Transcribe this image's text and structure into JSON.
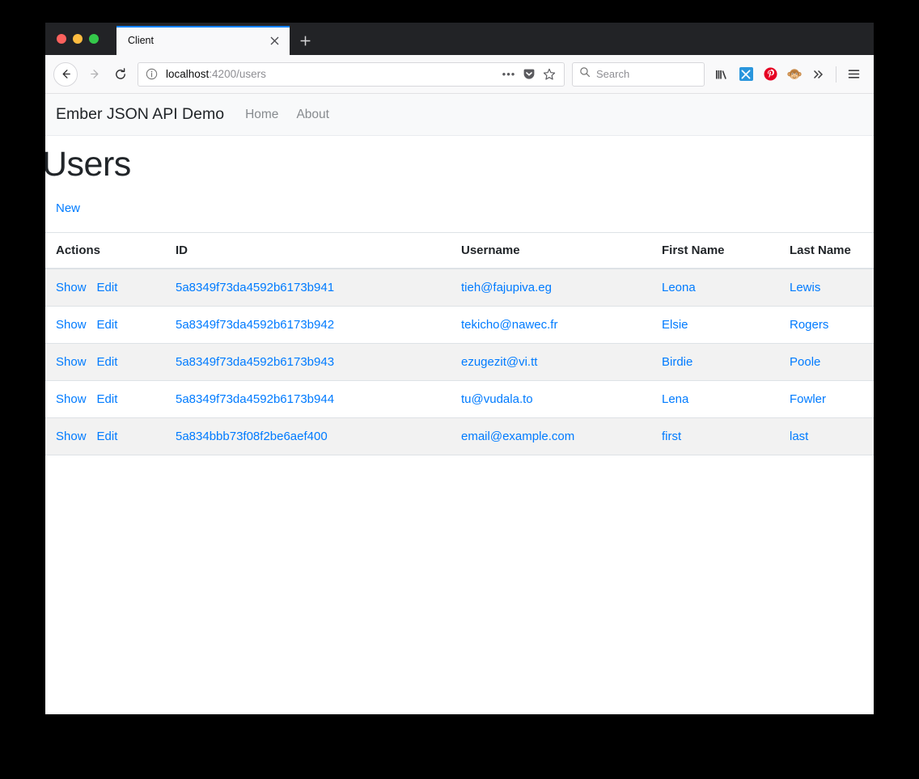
{
  "browser": {
    "traffic_lights": [
      "close",
      "minimize",
      "maximize"
    ],
    "tab": {
      "title": "Client",
      "close_label": "✕"
    },
    "new_tab_label": "+",
    "back_label": "←",
    "forward_label": "→",
    "reload_label": "↻",
    "url": {
      "host": "localhost",
      "path": ":4200/users"
    },
    "page_actions_label": "•••",
    "search": {
      "placeholder": "Search"
    },
    "extensions": [
      "library-icon",
      "xmarks-icon",
      "pinterest-icon",
      "monkey-icon"
    ],
    "overflow_label": "»",
    "menu_label": "☰",
    "accent_color": "#0a84ff"
  },
  "app": {
    "brand": "Ember JSON API Demo",
    "nav_links": [
      {
        "label": "Home"
      },
      {
        "label": "About"
      }
    ],
    "page_title": "Users",
    "new_link": "New",
    "link_color": "#007bff"
  },
  "table": {
    "columns": [
      "Actions",
      "ID",
      "Username",
      "First Name",
      "Last Name"
    ],
    "action_labels": {
      "show": "Show",
      "edit": "Edit"
    },
    "rows": [
      {
        "id": "5a8349f73da4592b6173b941",
        "username": "tieh@fajupiva.eg",
        "first_name": "Leona",
        "last_name": "Lewis"
      },
      {
        "id": "5a8349f73da4592b6173b942",
        "username": "tekicho@nawec.fr",
        "first_name": "Elsie",
        "last_name": "Rogers"
      },
      {
        "id": "5a8349f73da4592b6173b943",
        "username": "ezugezit@vi.tt",
        "first_name": "Birdie",
        "last_name": "Poole"
      },
      {
        "id": "5a8349f73da4592b6173b944",
        "username": "tu@vudala.to",
        "first_name": "Lena",
        "last_name": "Fowler"
      },
      {
        "id": "5a834bbb73f08f2be6aef400",
        "username": "email@example.com",
        "first_name": "first",
        "last_name": "last"
      }
    ]
  }
}
